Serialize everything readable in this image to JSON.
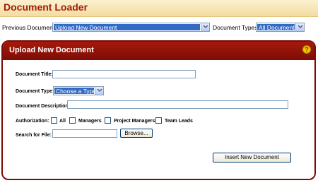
{
  "header": {
    "title": "Document Loader"
  },
  "filters": {
    "previous_label": "Previous Documents:",
    "previous_value": "Upload New Document",
    "types_label": "Document Types:",
    "types_value": "All Documents"
  },
  "panel": {
    "title": "Upload New Document",
    "help_glyph": "?",
    "fields": {
      "title_label": "Document Title:",
      "title_value": "",
      "type_label": "Document Type:",
      "type_value": "Choose a Type",
      "description_label": "Document Description:",
      "description_value": "",
      "authorization_label": "Authorization:",
      "authorization_options": [
        "All",
        "Managers",
        "Project Managers",
        "Team Leads"
      ],
      "search_label": "Search for File:",
      "search_value": "",
      "browse_label": "Browse...",
      "insert_label": "Insert New Document"
    }
  },
  "colors": {
    "title_red": "#a11d0b",
    "panel_red": "#8b1208",
    "select_blue": "#316ac5"
  }
}
